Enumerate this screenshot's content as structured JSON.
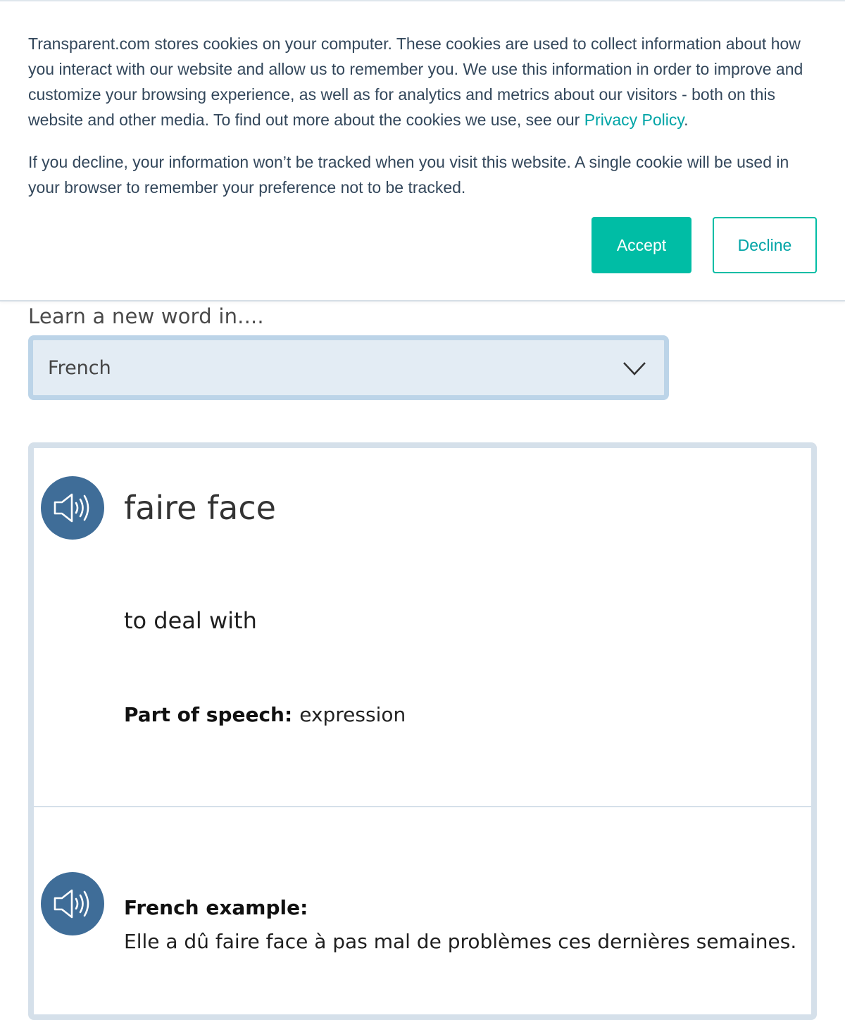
{
  "cookie_banner": {
    "paragraph1_text": "Transparent.com stores cookies on your computer. These cookies are used to collect information about how you interact with our website and allow us to remember you. We use this information in order to improve and customize your browsing experience, as well as for analytics and metrics about our visitors - both on this website and other media. To find out more about the cookies we use, see our ",
    "privacy_link": "Privacy Policy",
    "paragraph1_end": ".",
    "paragraph2_text": "If you decline, your information won’t be tracked when you visit this website. A single cookie will be used in your browser to remember your preference not to be tracked.",
    "accept_label": "Accept",
    "decline_label": "Decline",
    "accent_color": "#00bda5"
  },
  "language_picker": {
    "label": "Learn a new word in....",
    "selected": "French",
    "icon": "chevron-down-icon"
  },
  "word_card": {
    "word": "faire face",
    "translation": "to deal with",
    "part_of_speech_label": "Part of speech:",
    "part_of_speech": "expression",
    "example_label": "French example:",
    "example_sentence": "Elle a dû faire face à pas mal de problèmes ces dernières semaines.",
    "speaker_icon": "speaker-icon",
    "speaker_color": "#3f6d98"
  }
}
